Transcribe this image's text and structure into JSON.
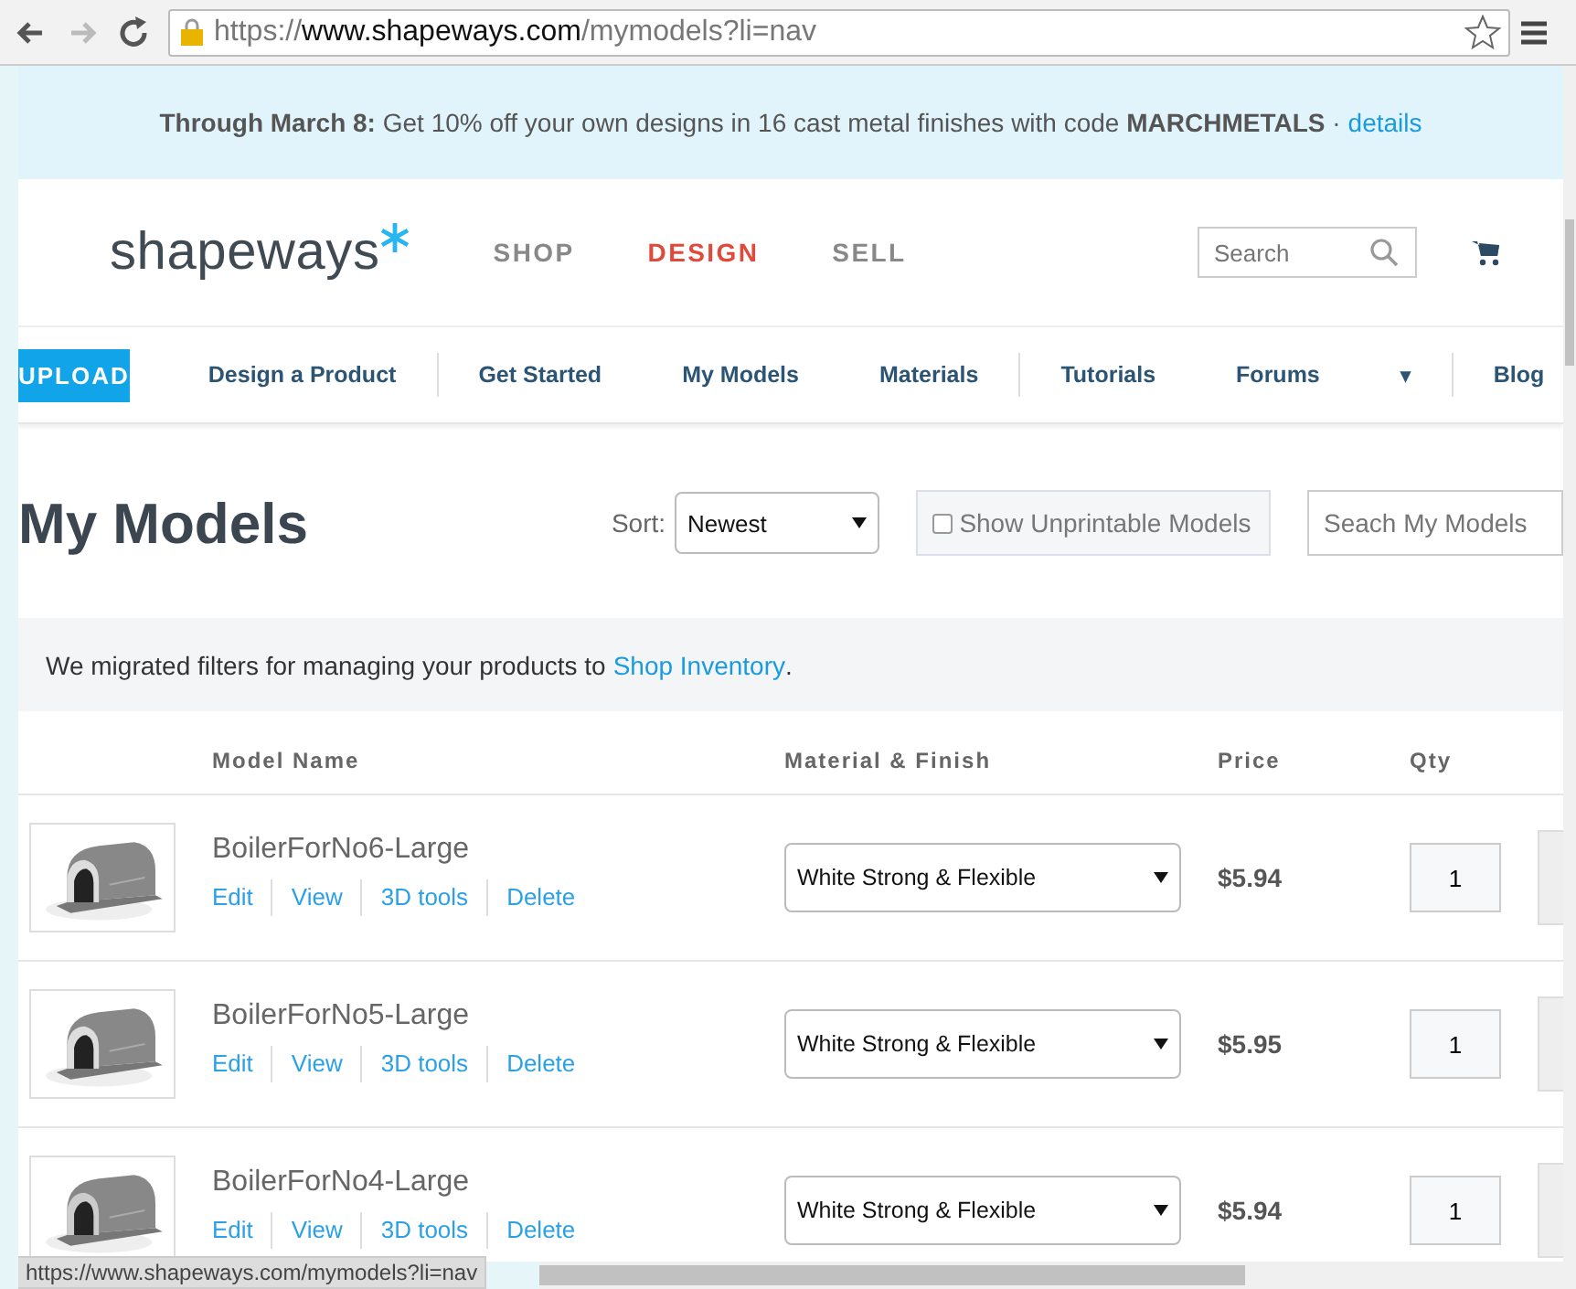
{
  "browser": {
    "url_host": "https://www.shapeways.com",
    "url_path": "/mymodels?li=nav"
  },
  "banner": {
    "text": "**Through March 8:** Get 10% off your own designs in 16 cast metal finishes with code **MARCHMETALS** ·",
    "link": "details"
  },
  "header": {
    "logo": "shapeways",
    "nav": [
      {
        "label": "SHOP",
        "selected": false
      },
      {
        "label": "DESIGN",
        "selected": true
      },
      {
        "label": "SELL",
        "selected": false
      }
    ],
    "search": {
      "placeholder": "Search"
    }
  },
  "subnav": {
    "upload": "UPLOAD",
    "items": [
      {
        "kind": "link",
        "label": "Design a Product",
        "divider_after": true
      },
      {
        "kind": "link",
        "label": "Get Started",
        "divider_after": false
      },
      {
        "kind": "link",
        "label": "My Models",
        "divider_after": false
      },
      {
        "kind": "link",
        "label": "Materials",
        "divider_after": true
      },
      {
        "kind": "link",
        "label": "Tutorials",
        "divider_after": false
      },
      {
        "kind": "link",
        "label": "Forums",
        "divider_after": false
      },
      {
        "kind": "dropdown",
        "label": "▾",
        "divider_after": true
      },
      {
        "kind": "link",
        "label": "Blog",
        "divider_after": false
      }
    ]
  },
  "page": {
    "title": "My Models",
    "sort_label": "Sort:",
    "sort_value": "Newest",
    "unprintable": {
      "label": "Show Unprintable Models",
      "checked": false
    },
    "search": {
      "placeholder": "Seach My Models"
    }
  },
  "notice": {
    "text": "We migrated filters for managing your products to",
    "link": "Shop Inventory",
    "tail": "."
  },
  "table": {
    "columns": [
      "Model Name",
      "Material & Finish",
      "Price",
      "Qty"
    ],
    "rows": [
      {
        "name": "BoilerForNo6-Large",
        "actions": [
          "Edit",
          "View",
          "3D tools",
          "Delete"
        ],
        "material": "White Strong & Flexible",
        "price": "$5.94",
        "qty": "1"
      },
      {
        "name": "BoilerForNo5-Large",
        "actions": [
          "Edit",
          "View",
          "3D tools",
          "Delete"
        ],
        "material": "White Strong & Flexible",
        "price": "$5.95",
        "qty": "1"
      },
      {
        "name": "BoilerForNo4-Large",
        "actions": [
          "Edit",
          "View",
          "3D tools",
          "Delete"
        ],
        "material": "White Strong & Flexible",
        "price": "$5.94",
        "qty": "1"
      }
    ]
  },
  "status_bar": {
    "url": "https://www.shapeways.com/mymodels?li=nav"
  }
}
